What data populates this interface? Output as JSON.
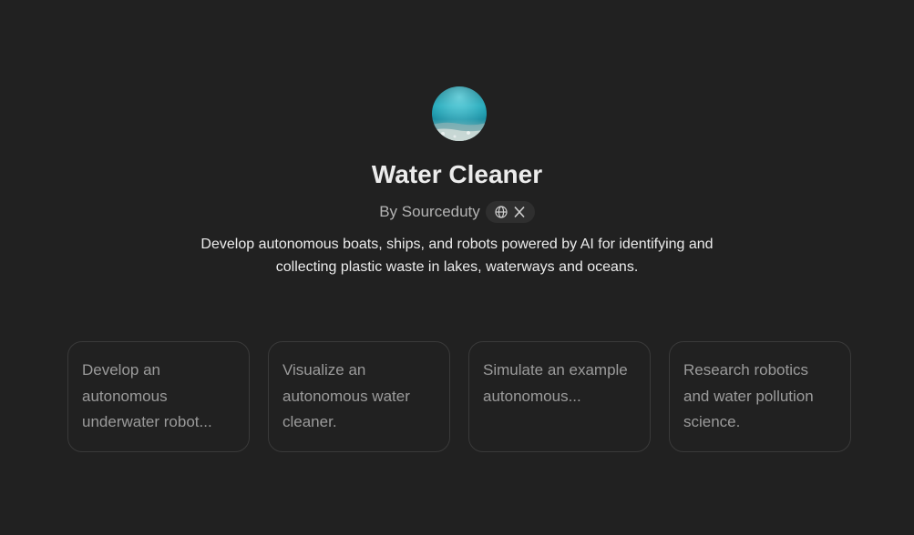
{
  "gpt": {
    "name": "Water Cleaner",
    "byline": "By Sourceduty",
    "description": "Develop autonomous boats, ships, and robots powered by AI for identifying and collecting plastic waste in lakes, waterways and oceans.",
    "avatar_icon": "underwater-ocean-image",
    "link_icons": [
      "globe-icon",
      "x-icon"
    ]
  },
  "starters": [
    {
      "text": "Develop an autonomous underwater robot..."
    },
    {
      "text": "Visualize an autonomous water cleaner."
    },
    {
      "text": "Simulate an example autonomous..."
    },
    {
      "text": "Research robotics and water pollution science."
    }
  ],
  "colors": {
    "background": "#212121",
    "card_border": "#3a3a3a",
    "text_primary": "#ececec",
    "text_secondary": "#9b9b9b"
  }
}
